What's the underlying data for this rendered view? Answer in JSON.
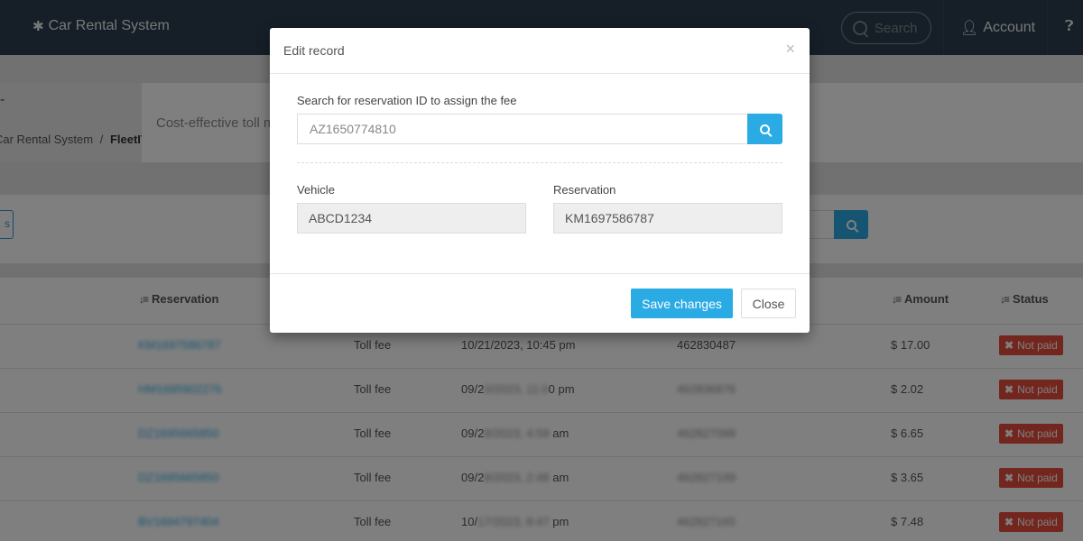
{
  "nav": {
    "brand": "Car Rental System",
    "search_placeholder": "Search",
    "account": "Account"
  },
  "page_header": {
    "breadcrumb_parent": "Car Rental System",
    "breadcrumb_separator": "/",
    "breadcrumb_current": "FleetIT",
    "description": "Cost-effective toll m"
  },
  "table": {
    "headers": {
      "reservation": "Reservation",
      "amount": "Amount",
      "status": "Status"
    },
    "rows": [
      {
        "type": "Toll fee",
        "datetime": "10/21/2023, 10:45 pm",
        "number": "462830487",
        "amount": "$ 17.00",
        "status": "Not paid"
      },
      {
        "type": "Toll fee",
        "datetime_a": "09/2",
        "datetime_b": "0 pm",
        "amount": "$ 2.02",
        "status": "Not paid"
      },
      {
        "type": "Toll fee",
        "datetime_a": "09/2",
        "datetime_b": "am",
        "amount": "$ 6.65",
        "status": "Not paid"
      },
      {
        "type": "Toll fee",
        "datetime_a": "09/2",
        "datetime_b": "am",
        "amount": "$ 3.65",
        "status": "Not paid"
      },
      {
        "type": "Toll fee",
        "datetime_a": "10/",
        "datetime_b": "pm",
        "amount": "$ 7.48",
        "status": "Not paid"
      }
    ]
  },
  "modal": {
    "title": "Edit record",
    "close_glyph": "×",
    "search_label": "Search for reservation ID to assign the fee",
    "search_value": "AZ1650774810",
    "vehicle_label": "Vehicle",
    "vehicle_value": "ABCD1234",
    "reservation_label": "Reservation",
    "reservation_value": "KM1697586787",
    "save_label": "Save changes",
    "close_label": "Close"
  },
  "colors": {
    "nav_bg": "#2c3e50",
    "accent": "#2aabe4",
    "danger": "#e74c3c"
  }
}
